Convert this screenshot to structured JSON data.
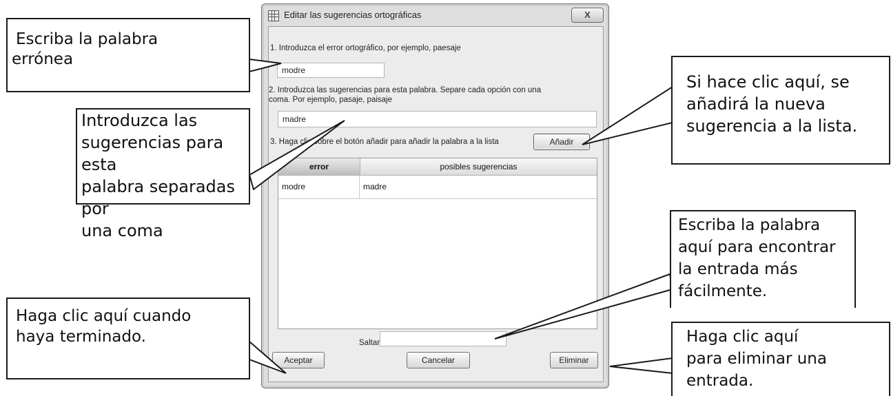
{
  "dialog": {
    "title": "Editar las sugerencias ortográficas",
    "close_label": "X",
    "step1_label": "1. Introduzca el error ortográfico, por ejemplo, paesaje",
    "error_value": "modre",
    "step2_line1": "2. Introduzca las sugerencias para esta palabra. Separe cada opción con una",
    "step2_line2": "coma. Por ejemplo, pasaje, paisaje",
    "suggestions_value": "madre",
    "step3_label": "3. Haga clic sobre el botón añadir para añadir la palabra a la lista",
    "add_button": "Añadir",
    "table": {
      "headers": [
        "error",
        "posibles sugerencias"
      ],
      "rows": [
        [
          "modre",
          "madre"
        ]
      ]
    },
    "jump_label": "Saltar a",
    "jump_value": "",
    "accept_button": "Aceptar",
    "cancel_button": "Cancelar",
    "delete_button": "Eliminar"
  },
  "callouts": {
    "type_word": [
      "Escriba la palabra",
      "errónea"
    ],
    "suggestions": [
      "Introduzca las",
      "sugerencias para esta",
      "palabra separadas por",
      "una coma"
    ],
    "add": [
      "Si hace clic aquí, se",
      "añadirá la nueva",
      "sugerencia a la lista."
    ],
    "find": [
      "Escriba la palabra",
      "aquí para encontrar",
      "la entrada más",
      "fácilmente."
    ],
    "done": [
      "Haga clic aquí cuando",
      "haya terminado."
    ],
    "delete": [
      "Haga clic aquí",
      "para eliminar una",
      "entrada."
    ]
  }
}
